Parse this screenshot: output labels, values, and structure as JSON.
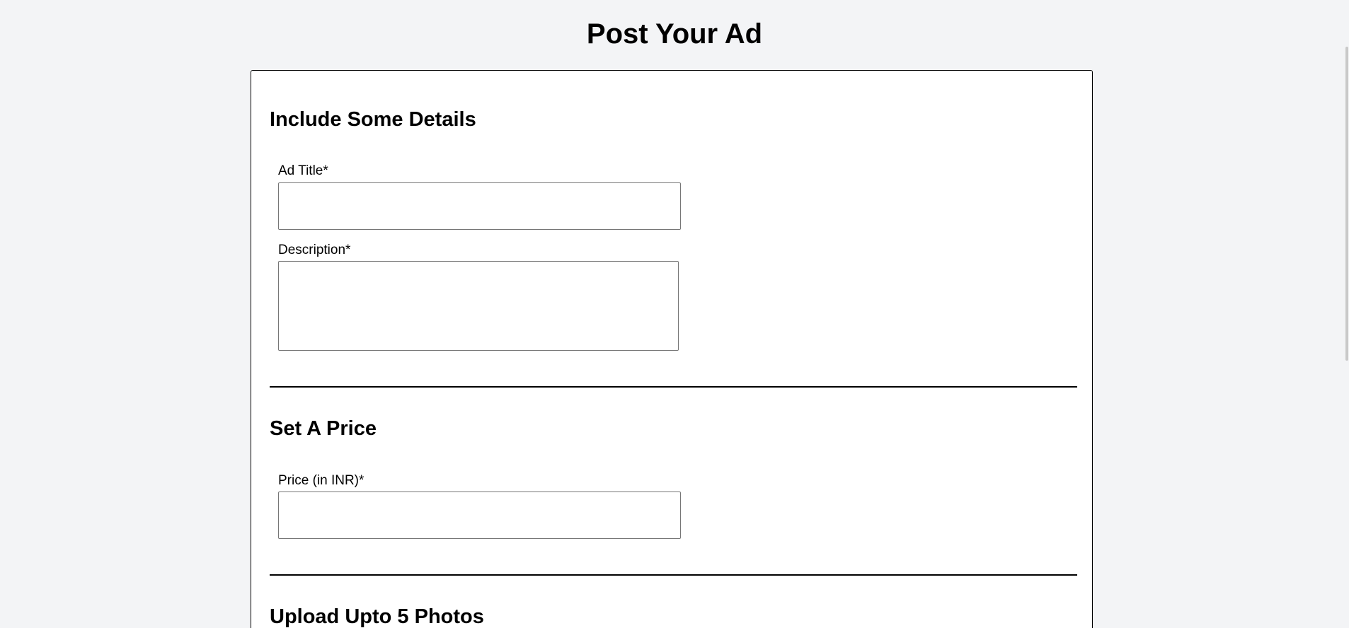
{
  "page": {
    "title": "Post Your Ad"
  },
  "details_section": {
    "heading": "Include Some Details",
    "ad_title_label": "Ad Title*",
    "ad_title_value": "",
    "description_label": "Description*",
    "description_value": ""
  },
  "price_section": {
    "heading": "Set A Price",
    "price_label": "Price (in INR)*",
    "price_value": ""
  },
  "photos_section": {
    "heading": "Upload Upto 5 Photos"
  },
  "colors": {
    "page_background": "#f3f4f6",
    "card_background": "#ffffff",
    "border": "#000000",
    "input_border": "#767676"
  }
}
